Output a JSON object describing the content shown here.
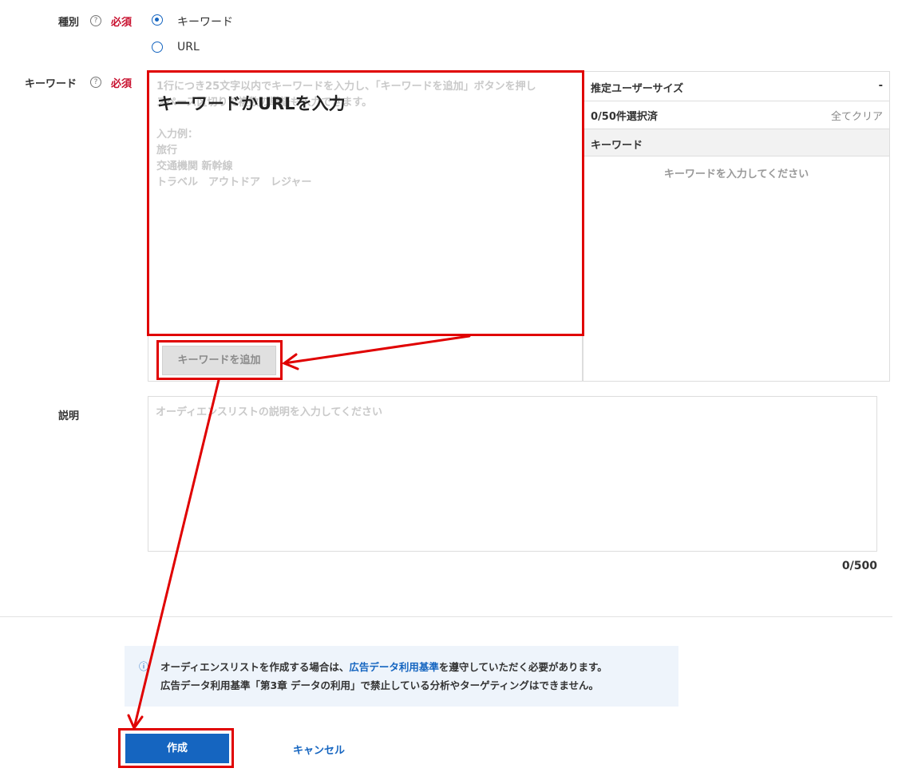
{
  "form": {
    "type_label": "種別",
    "required": "必須",
    "help_glyph": "?",
    "type_options": [
      {
        "label": "キーワード",
        "selected": true
      },
      {
        "label": "URL",
        "selected": false
      }
    ],
    "keyword_label": "キーワード",
    "description_label": "説明"
  },
  "keyword_input": {
    "placeholder_lines": [
      "1行につき25文字以内でキーワードを入力し、「キーワードを追加」ボタンを押し",
      "スペース区切りで複数の単語も入力できます。",
      "",
      "入力例：",
      "旅行",
      "交通機関 新幹線",
      "トラベル　アウトドア　レジャー"
    ],
    "add_button": "キーワードを追加"
  },
  "side_panel": {
    "estimated_size_label": "推定ユーザーサイズ",
    "estimated_size_value": "-",
    "selected_count": "0/50件選択済",
    "clear_all": "全てクリア",
    "keyword_header": "キーワード",
    "empty_message": "キーワードを入力してください"
  },
  "description": {
    "placeholder": "オーディエンスリストの説明を入力してください",
    "counter": "0/500"
  },
  "notice": {
    "line1_before": "オーディエンスリストを作成する場合は、",
    "line1_link": "広告データ利用基準",
    "line1_after": "を遵守していただく必要があります。",
    "line2": "広告データ利用基準「第3章 データの利用」で禁止している分析やターゲティングはできません。",
    "icon": "ⓘ"
  },
  "actions": {
    "create": "作成",
    "cancel": "キャンセル"
  },
  "annotation": {
    "callout": "キーワードかURLを入力",
    "color": "#e00000"
  },
  "colors": {
    "primary": "#1565c0",
    "required": "#c8102e",
    "notice_bg": "#eef4fb"
  }
}
